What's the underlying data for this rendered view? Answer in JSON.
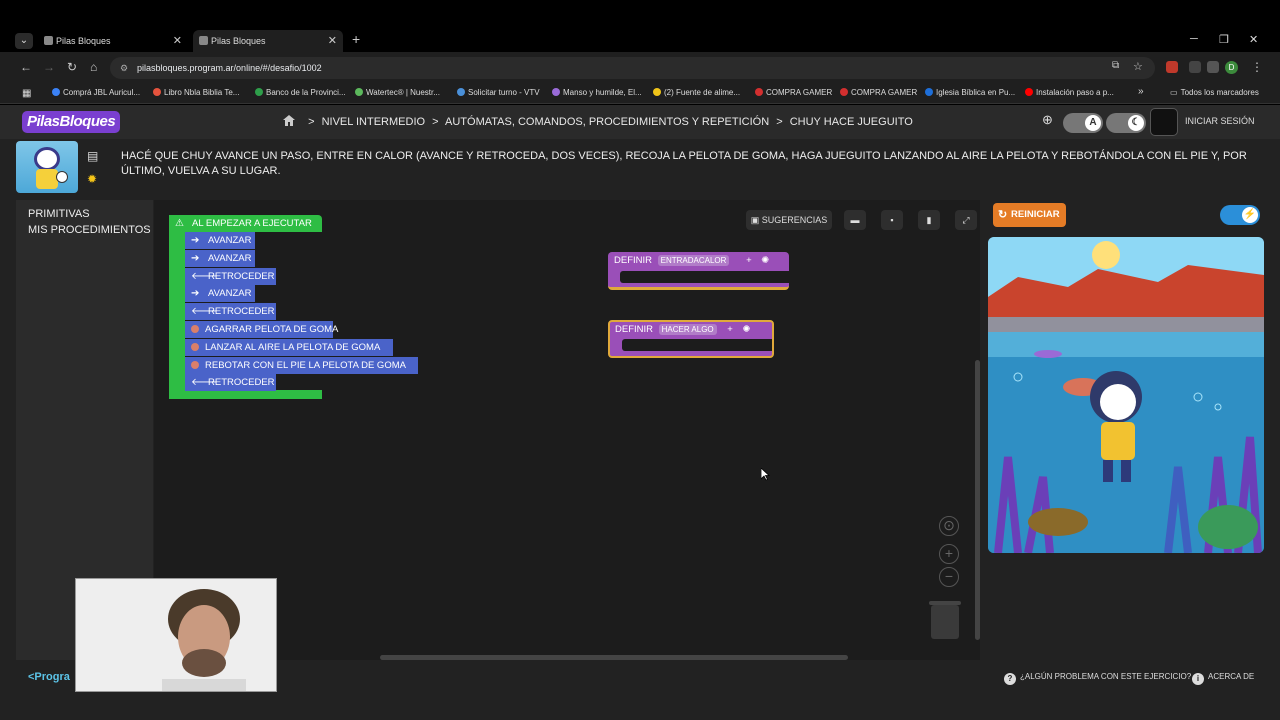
{
  "browser": {
    "tabs": [
      {
        "title": "Pilas Bloques"
      },
      {
        "title": "Pilas Bloques"
      }
    ],
    "url": "pilasbloques.program.ar/online/#/desafio/1002",
    "bookmarks": [
      {
        "label": "Comprá JBL Auricul...",
        "color": "#3b82f6"
      },
      {
        "label": "Libro Nbla Biblia Te...",
        "color": "#e5533d"
      },
      {
        "label": "Banco de la Provinci...",
        "color": "#2e9e4a"
      },
      {
        "label": "Watertec® | Nuestr...",
        "color": "#5cb85c"
      },
      {
        "label": "Solicitar turno - VTV",
        "color": "#4a90d9"
      },
      {
        "label": "Manso y humilde, El...",
        "color": "#9a6bd8"
      },
      {
        "label": "(2) Fuente de alime...",
        "color": "#f0c419"
      },
      {
        "label": "COMPRA GAMER",
        "color": "#d32f2f"
      },
      {
        "label": "COMPRA GAMER",
        "color": "#d32f2f"
      },
      {
        "label": "Iglesia Bíblica en Pu...",
        "color": "#1e6fd9"
      },
      {
        "label": "Instalación paso a p...",
        "color": "#ff0000"
      }
    ],
    "bookmarks_overflow": "»",
    "all_bookmarks": "Todos los marcadores",
    "profile_initial": "D"
  },
  "app": {
    "logo": "PilasBloques",
    "breadcrumb": [
      "NIVEL INTERMEDIO",
      "AUTÓMATAS, COMANDOS, PROCEDIMIENTOS Y REPETICIÓN",
      "CHUY HACE JUEGUITO"
    ],
    "breadcrumb_sep": ">",
    "login": "INICIAR SESIÓN",
    "contrast_toggle": "A",
    "challenge_text": "HACÉ QUE CHUY AVANCE UN PASO, ENTRE EN CALOR (AVANCE Y RETROCEDA, DOS VECES), RECOJA LA PELOTA DE GOMA, HAGA JUEGUITO LANZANDO AL AIRE LA PELOTA Y REBOTÁNDOLA CON EL PIE Y, POR ÚLTIMO, VUELVA A SU LUGAR."
  },
  "palette": {
    "categories": [
      "PRIMITIVAS",
      "MIS PROCEDIMIENTOS"
    ]
  },
  "workspace": {
    "toolbar": {
      "suggestions": "SUGERENCIAS"
    },
    "main_block": "AL EMPEZAR A EJECUTAR",
    "steps": [
      {
        "label": "AVANZAR",
        "kind": "forward"
      },
      {
        "label": "AVANZAR",
        "kind": "forward"
      },
      {
        "label": "RETROCEDER",
        "kind": "back"
      },
      {
        "label": "AVANZAR",
        "kind": "forward"
      },
      {
        "label": "RETROCEDER",
        "kind": "back"
      },
      {
        "label": "AGARRAR PELOTA DE GOMA",
        "kind": "ball"
      },
      {
        "label": "LANZAR AL AIRE LA PELOTA DE GOMA",
        "kind": "ball"
      },
      {
        "label": "REBOTAR CON EL PIE LA PELOTA DE GOMA",
        "kind": "ball"
      },
      {
        "label": "RETROCEDER",
        "kind": "back"
      }
    ],
    "procedures": [
      {
        "keyword": "DEFINIR",
        "name": "ENTRADACALOR"
      },
      {
        "keyword": "DEFINIR",
        "name": "HACER ALGO"
      }
    ]
  },
  "stage": {
    "reset": "REINICIAR"
  },
  "footer": {
    "brand": "<Progra",
    "problem": "¿ALGÚN PROBLEMA CON ESTE EJERCICIO?",
    "about": "ACERCA DE"
  },
  "colors": {
    "block_blue": "#4a63c9",
    "block_green": "#2ebd44",
    "block_purple": "#9a4fb8",
    "reset_orange": "#e57c26",
    "logo_purple": "#7a3fd0"
  }
}
